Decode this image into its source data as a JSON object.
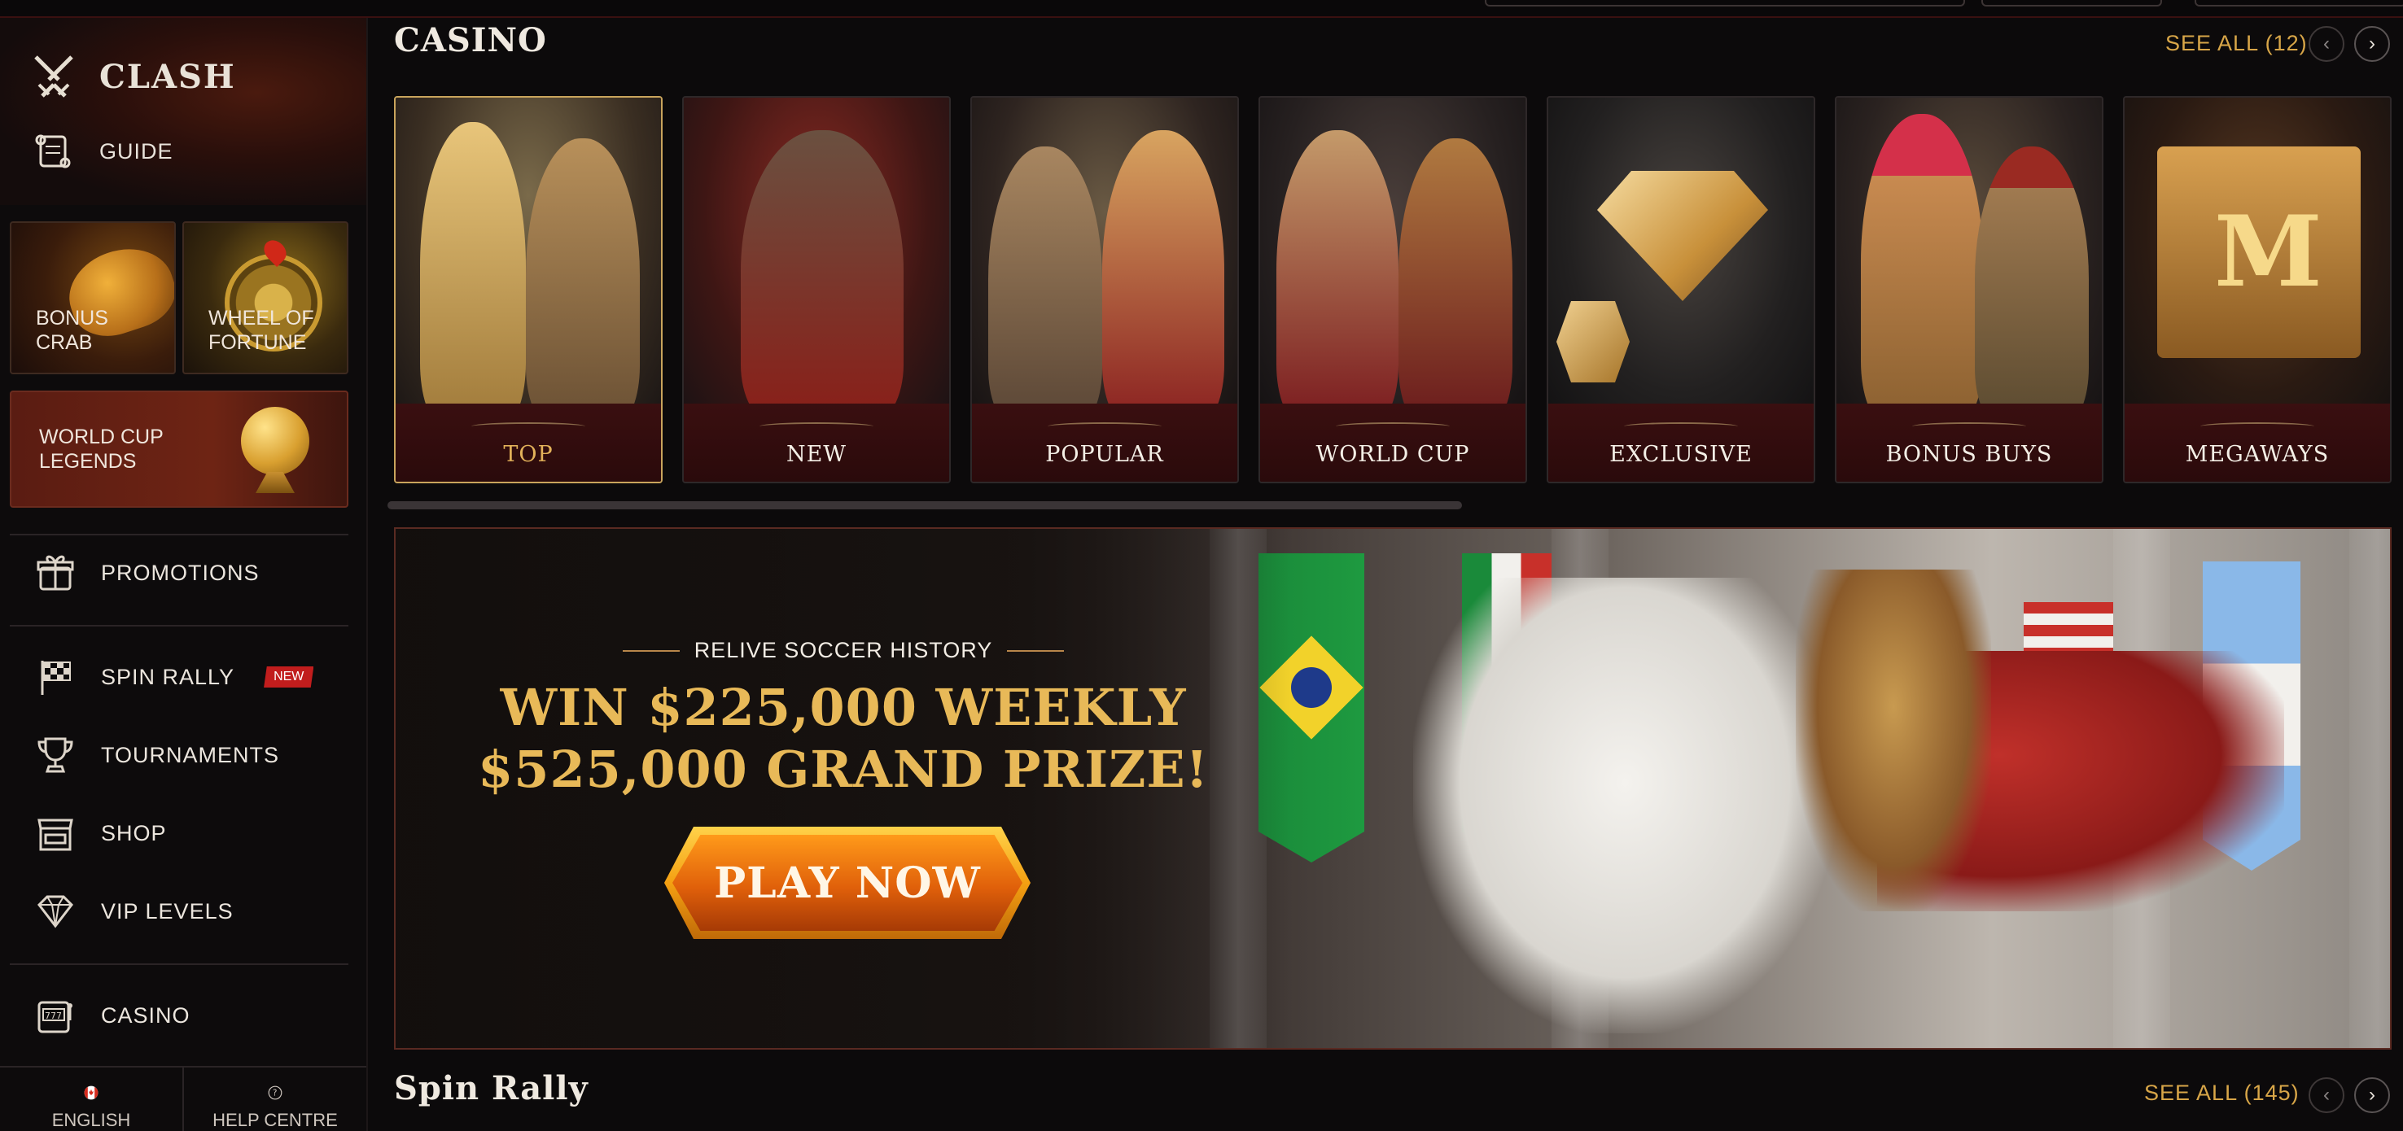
{
  "sidebar": {
    "brand": "CLASH",
    "guide": "GUIDE",
    "promo_tiles": {
      "bonus_crab": "BONUS\nCRAB",
      "wheel_of_fortune": "WHEEL OF\nFORTUNE",
      "world_cup_legends": "WORLD CUP\nLEGENDS"
    },
    "nav": {
      "promotions": "PROMOTIONS",
      "spin_rally": "SPIN RALLY",
      "spin_rally_badge": "NEW",
      "tournaments": "TOURNAMENTS",
      "shop": "SHOP",
      "vip_levels": "VIP LEVELS",
      "casino": "CASINO"
    },
    "bottom": {
      "language": "ENGLISH",
      "help": "HELP CENTRE"
    }
  },
  "casino": {
    "title": "CASINO",
    "see_all": "SEE ALL (12)",
    "categories": [
      "TOP",
      "NEW",
      "POPULAR",
      "WORLD CUP",
      "EXCLUSIVE",
      "BONUS BUYS",
      "MEGAWAYS"
    ],
    "active_category": "TOP"
  },
  "banner": {
    "kicker": "RELIVE SOCCER HISTORY",
    "headline_1": "WIN $225,000 WEEKLY",
    "headline_2": "$525,000 GRAND PRIZE!",
    "cta": "PLAY NOW"
  },
  "spin_rally": {
    "title": "Spin Rally",
    "see_all": "SEE ALL (145)"
  },
  "colors": {
    "accent_gold": "#d8a648",
    "badge_red": "#c11d1d",
    "background": "#0c0a0b"
  },
  "icons": {
    "brand": "crossed-swords-icon",
    "guide": "scroll-icon",
    "promotions": "gift-icon",
    "spin_rally": "checkered-flag-icon",
    "tournaments": "trophy-icon",
    "shop": "shop-stall-icon",
    "vip": "diamond-icon",
    "casino": "slot-machine-icon",
    "language": "canada-flag-icon",
    "help": "question-circle-icon"
  }
}
